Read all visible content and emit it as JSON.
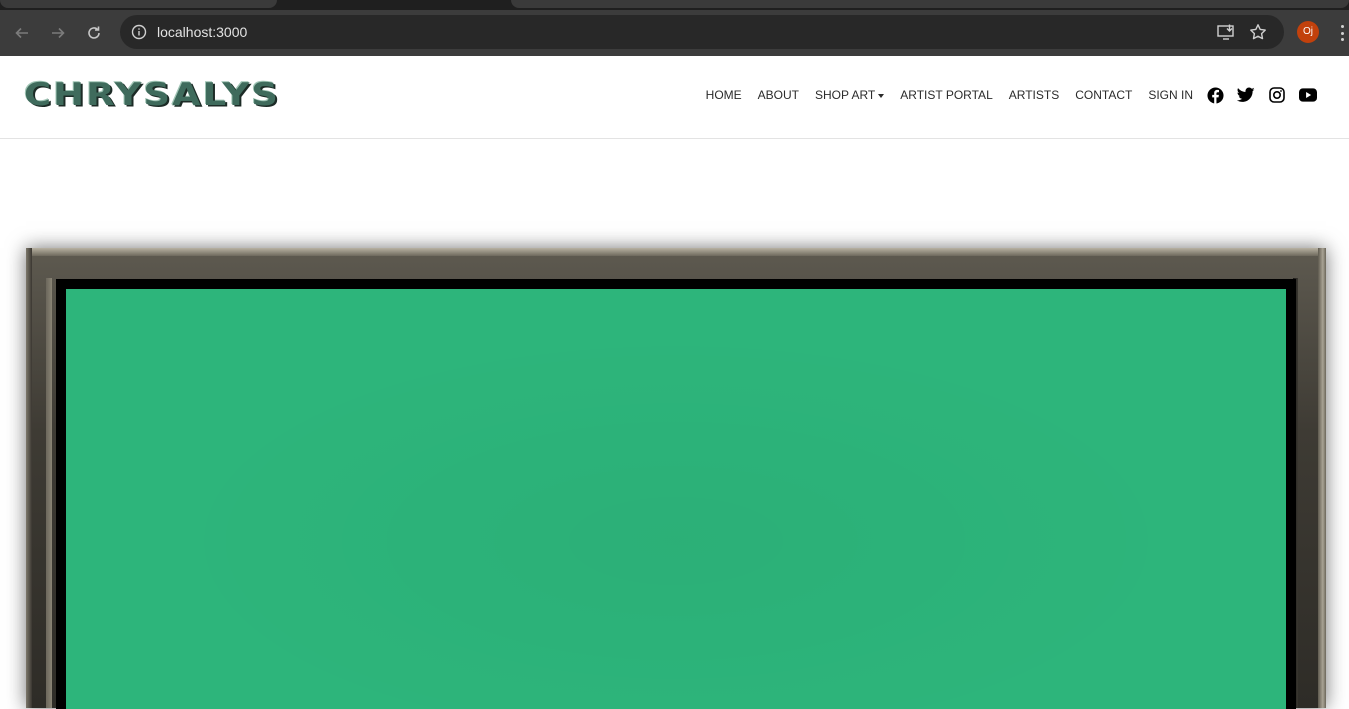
{
  "browser": {
    "url": "localhost:3000",
    "profile_initials": "Oj",
    "icons": {
      "back": "arrow-left-icon",
      "forward": "arrow-right-icon",
      "reload": "reload-icon",
      "site_info": "info-icon",
      "install": "install-app-icon",
      "bookmark": "star-icon",
      "menu": "kebab-menu-icon"
    }
  },
  "header": {
    "logo_text": "CHRYSALYS",
    "nav": {
      "home": "HOME",
      "about": "ABOUT",
      "shop_art": "SHOP ART",
      "artist_portal": "ARTIST PORTAL",
      "artists": "ARTISTS",
      "contact": "CONTACT",
      "sign_in": "SIGN IN"
    },
    "social_icons": [
      "facebook-icon",
      "twitter-icon",
      "instagram-icon",
      "youtube-icon"
    ]
  },
  "hero": {
    "artwork_color": "#2db57b",
    "frame_color": "#3e3b34"
  }
}
